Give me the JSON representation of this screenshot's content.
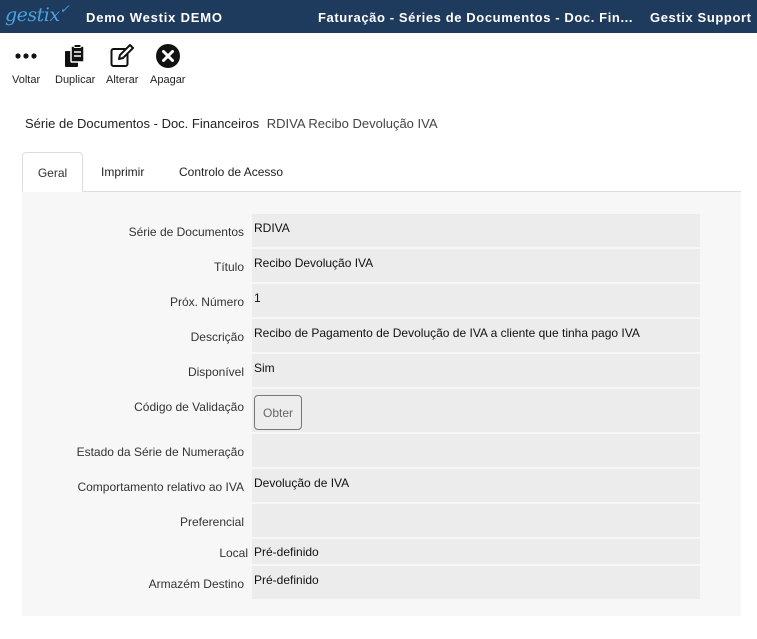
{
  "topbar": {
    "logo": "gestix",
    "company": "Demo Westix DEMO",
    "module": "Faturação - Séries de Documentos - Doc. Fin...",
    "user": "Gestix Support"
  },
  "toolbar": {
    "back_label": "Voltar",
    "duplicate_label": "Duplicar",
    "edit_label": "Alterar",
    "delete_label": "Apagar"
  },
  "page": {
    "title": "Série de Documentos - Doc. Financeiros",
    "subtitle": "RDIVA Recibo Devolução IVA"
  },
  "tabs": [
    {
      "label": "Geral"
    },
    {
      "label": "Imprimir"
    },
    {
      "label": "Controlo de Acesso"
    }
  ],
  "form": {
    "serie": {
      "label": "Série de Documentos",
      "value": "RDIVA"
    },
    "titulo": {
      "label": "Título",
      "value": "Recibo Devolução IVA"
    },
    "prox_numero": {
      "label": "Próx. Número",
      "value": "1"
    },
    "descricao": {
      "label": "Descrição",
      "value": "Recibo de Pagamento de Devolução de IVA a cliente que tinha pago IVA"
    },
    "disponivel": {
      "label": "Disponível",
      "value": "Sim"
    },
    "codigo_validacao": {
      "label": "Código de Validação",
      "button_label": "Obter"
    },
    "estado_serie": {
      "label": "Estado da Série de Numeração",
      "value": ""
    },
    "comportamento_iva": {
      "label": "Comportamento relativo ao IVA",
      "value": "Devolução de IVA"
    },
    "preferencial": {
      "label": "Preferencial",
      "value": ""
    },
    "local": {
      "label": "Local",
      "value": "Pré-definido"
    },
    "armazem_destino": {
      "label": "Armazém Destino",
      "value": "Pré-definido"
    }
  },
  "colors": {
    "topbar_bg": "#1e3a5c",
    "logo": "#4aa3e0",
    "field_bg": "#ececec",
    "panel_bg": "#f7f7f7"
  }
}
